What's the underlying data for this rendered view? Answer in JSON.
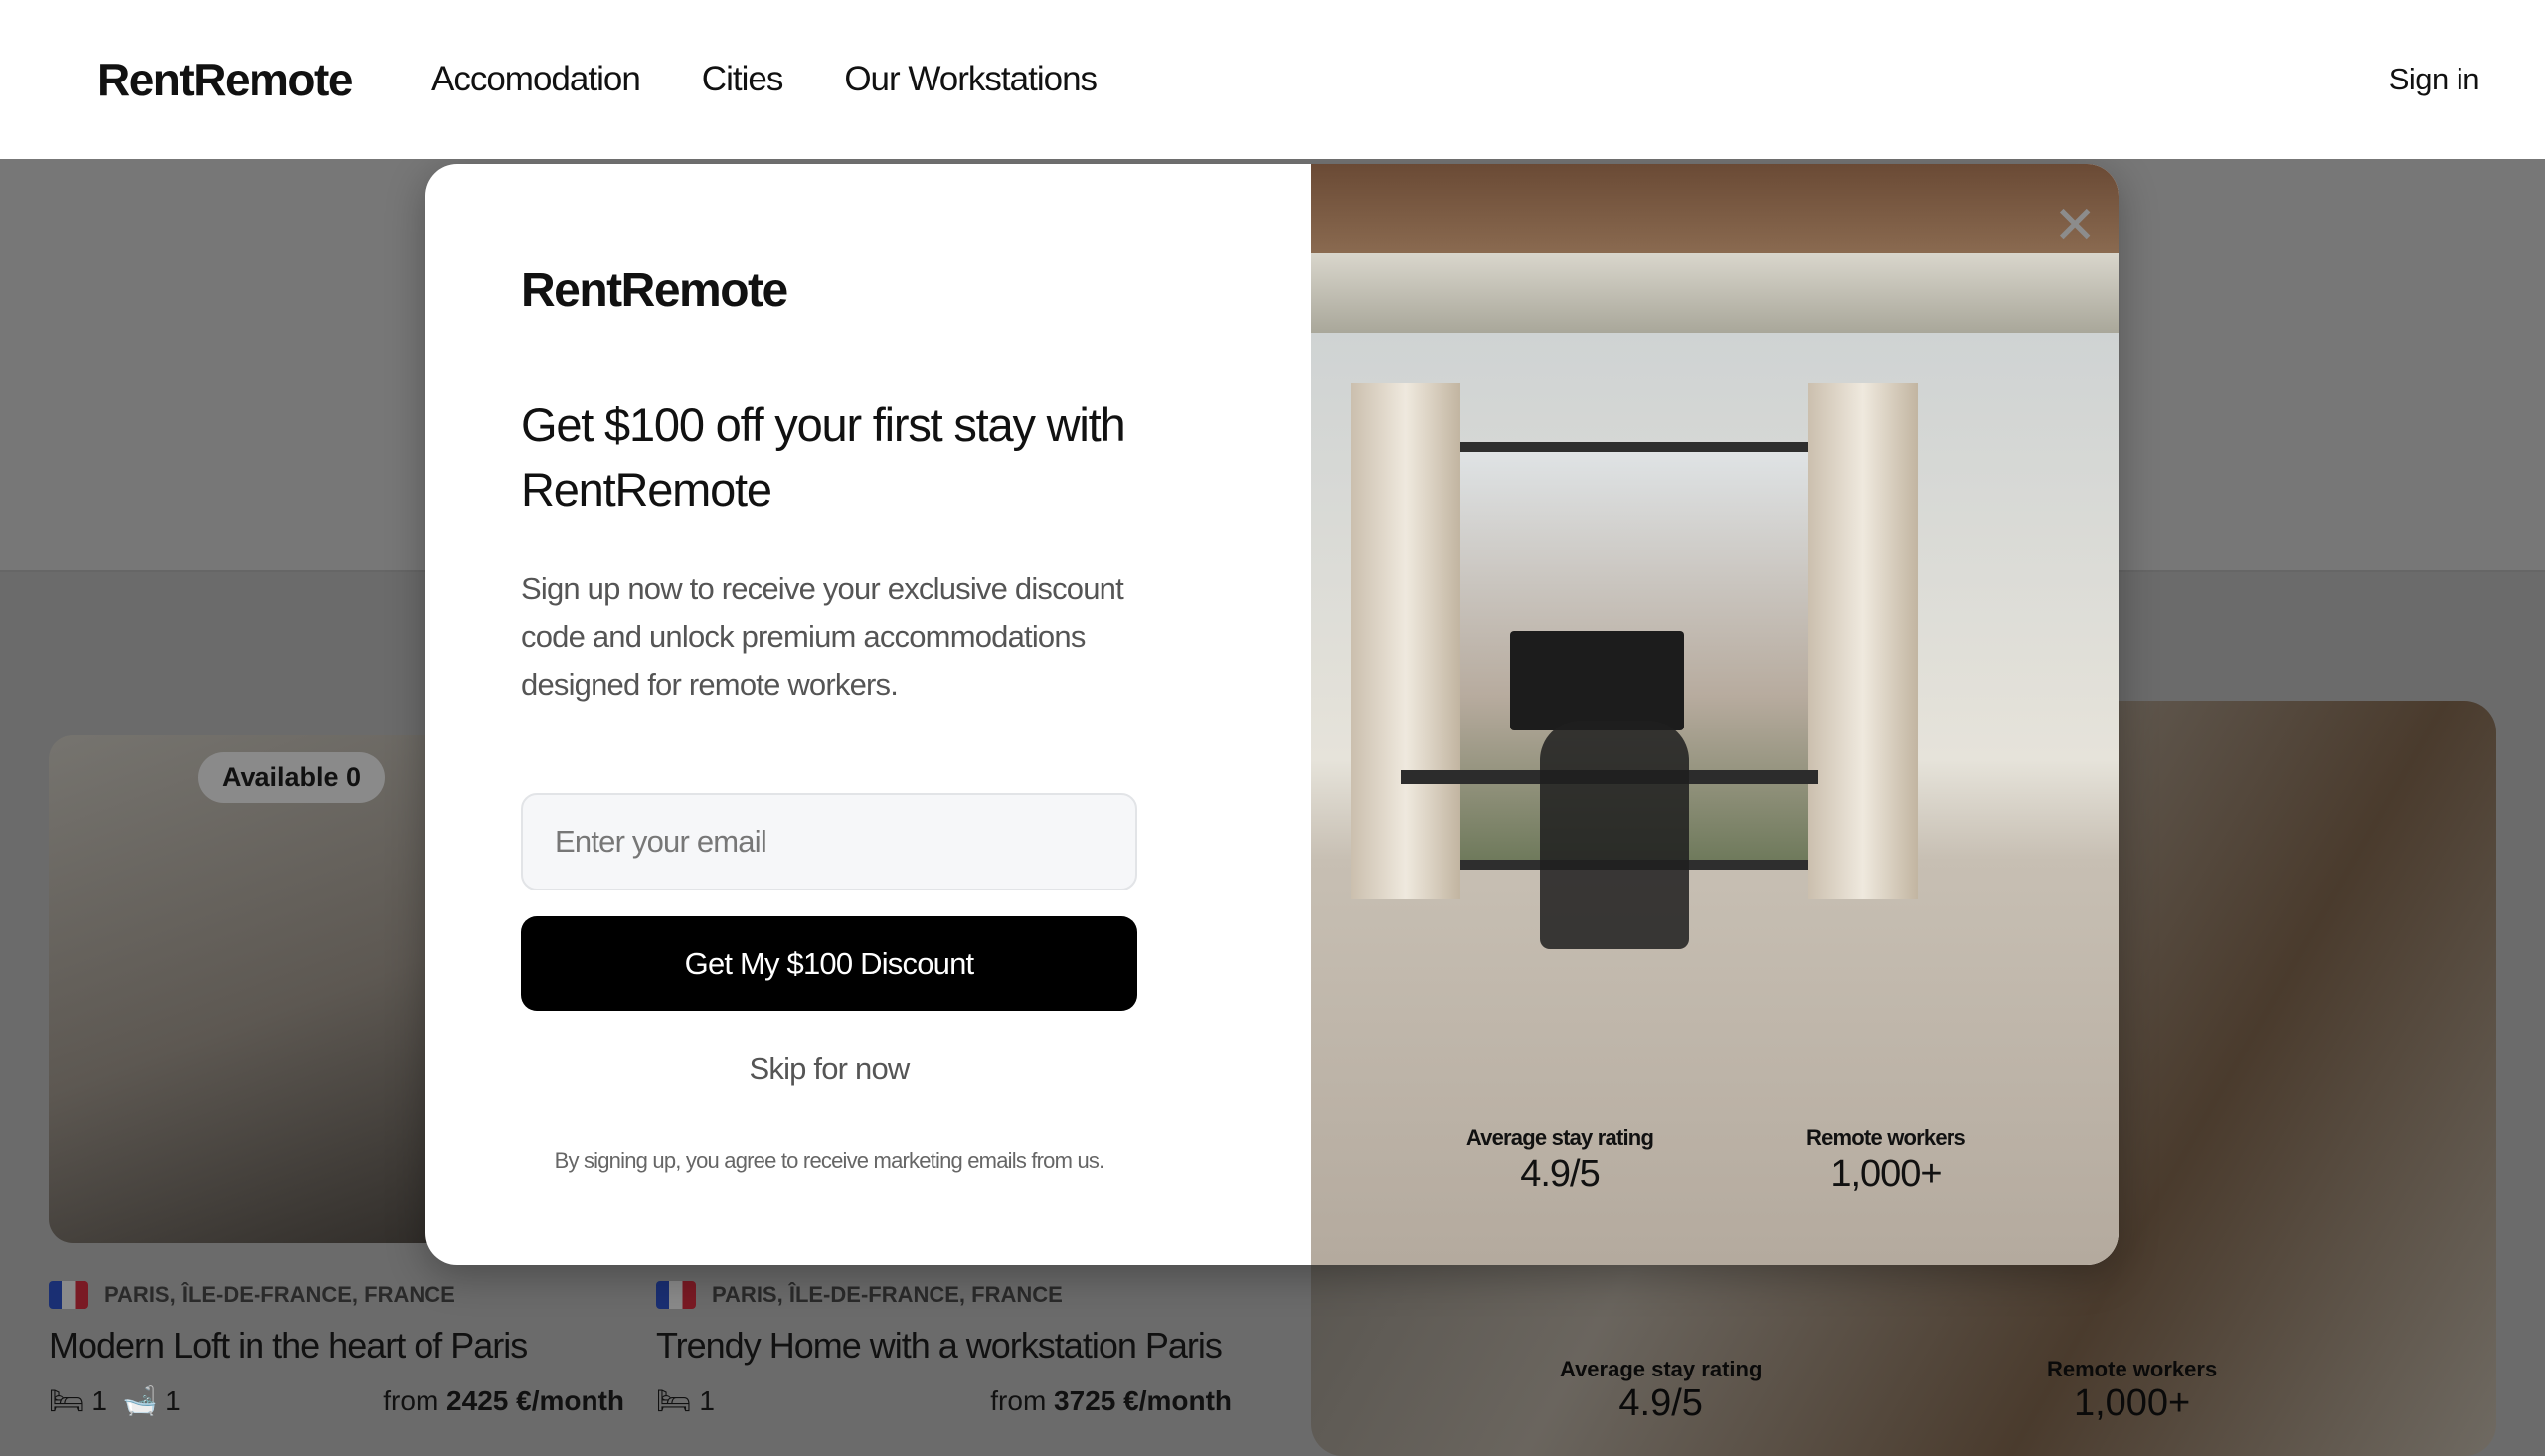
{
  "header": {
    "logo": "RentRemote",
    "nav": [
      "Accomodation",
      "Cities",
      "Our Workstations"
    ],
    "sign_in": "Sign in"
  },
  "listings": [
    {
      "badge": "Available 0",
      "location": "PARIS, ÎLE-DE-FRANCE, FRANCE",
      "title": "Modern Loft in the heart of Paris",
      "beds": "1",
      "baths": "1",
      "price_prefix": "from",
      "price": "2425 €/month"
    },
    {
      "location": "PARIS, ÎLE-DE-FRANCE, FRANCE",
      "title": "Trendy Home with a workstation Paris",
      "beds": "1",
      "price_prefix": "from",
      "price": "3725 €/month"
    }
  ],
  "background_stats": [
    {
      "label": "Average stay rating",
      "value": "4.9/5"
    },
    {
      "label": "Remote workers",
      "value": "1,000+"
    }
  ],
  "modal": {
    "logo": "RentRemote",
    "heading": "Get $100 off your first stay with RentRemote",
    "description": "Sign up now to receive your exclusive discount code and unlock premium accommodations designed for remote workers.",
    "email_placeholder": "Enter your email",
    "cta": "Get My $100 Discount",
    "skip": "Skip for now",
    "disclaimer": "By signing up, you agree to receive marketing emails from us.",
    "stats": [
      {
        "label": "Average stay rating",
        "value": "4.9/5"
      },
      {
        "label": "Remote workers",
        "value": "1,000+"
      }
    ],
    "close_icon": "close-icon"
  }
}
